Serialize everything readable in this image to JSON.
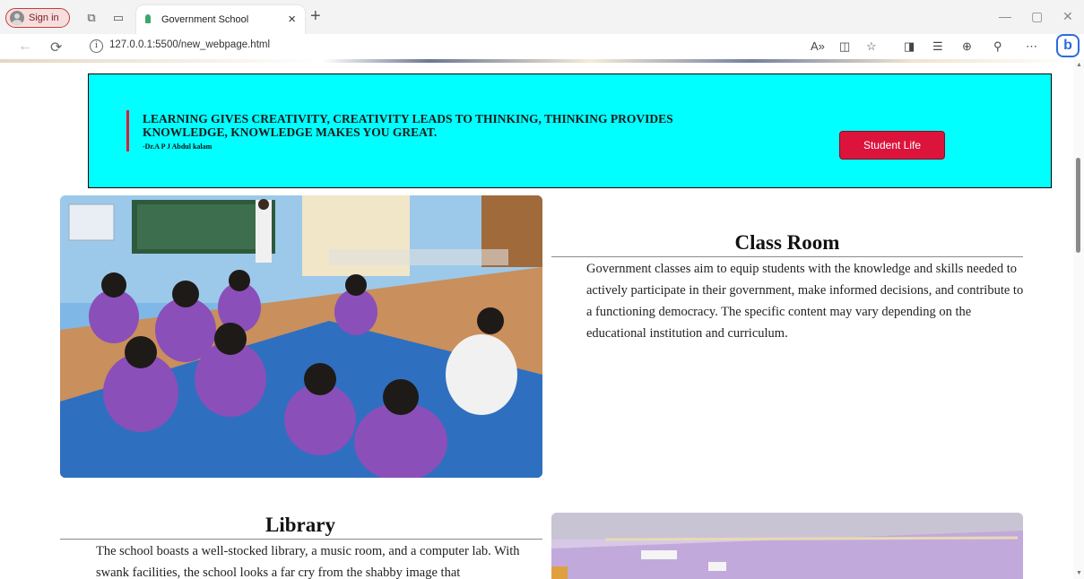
{
  "browser": {
    "sign_in": "Sign in",
    "tab_title": "Government School",
    "tab_close": "×",
    "new_tab": "+",
    "url": "127.0.0.1:5500/new_webpage.html",
    "window_minimize": "—",
    "window_restore": "▢",
    "window_close": "✕"
  },
  "banner": {
    "quote": "LEARNING GIVES CREATIVITY, CREATIVITY LEADS TO THINKING, THINKING PROVIDES KNOWLEDGE, KNOWLEDGE MAKES YOU GREAT.",
    "author": "-Dr.A P J Abdul kalam",
    "button_label": "Student Life",
    "bg_color": "#00ffff",
    "accent_color": "#dc143c"
  },
  "classroom": {
    "title": "Class Room",
    "text": "Government classes aim to equip students with the knowledge and skills needed to actively participate in their government, make informed decisions, and contribute to a functioning democracy. The specific content may vary depending on the educational institution and curriculum."
  },
  "library": {
    "title": "Library",
    "text": "The school boasts a well-stocked library, a music room, and a computer lab. With swank facilities, the school looks a far cry from the shabby image that"
  }
}
